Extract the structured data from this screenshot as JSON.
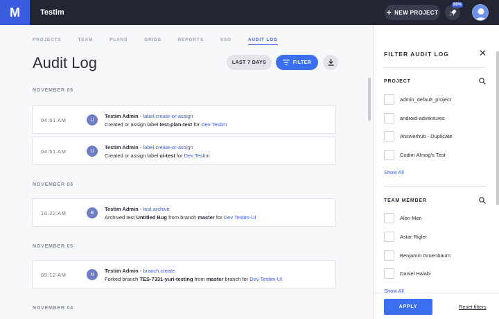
{
  "app": {
    "logo_letter": "M",
    "title": "Testim"
  },
  "header": {
    "new_project_label": "NEW PROJECT",
    "usage_badge": "80%",
    "rocket_icon": "rocket-icon",
    "avatar_icon": "user-avatar-icon"
  },
  "nav": {
    "items": [
      "PROJECTS",
      "TEAM",
      "PLANS",
      "GRIDS",
      "REPORTS",
      "SSO",
      "AUDIT LOG"
    ],
    "active": "AUDIT LOG"
  },
  "page": {
    "title": "Audit Log",
    "range_label": "LAST 7 DAYS",
    "filter_label": "FILTER"
  },
  "log_groups": [
    {
      "date": "NOVEMBER 08",
      "entries": [
        {
          "time": "04:51 AM",
          "initial": "U",
          "user": "Testim Admin",
          "action": "label.create-or-assign",
          "parts": [
            "Created or assign label ",
            "test-plan-test",
            " for ",
            "Dev Testim"
          ]
        },
        {
          "time": "04:51 AM",
          "initial": "U",
          "user": "Testim Admin",
          "action": "label.create-or-assign",
          "parts": [
            "Created or assign label ",
            "ui-test",
            " for ",
            "Dev Testim"
          ]
        }
      ]
    },
    {
      "date": "NOVEMBER 06",
      "entries": [
        {
          "time": "10:22 AM",
          "initial": "B",
          "user": "Testim Admin",
          "action": "test.archive",
          "parts": [
            "Archived test ",
            "Untitled Bug",
            " from branch ",
            "master",
            " for ",
            "Dev Testim-UI"
          ]
        }
      ]
    },
    {
      "date": "NOVEMBER 05",
      "entries": [
        {
          "time": "09:12 AM",
          "initial": "N",
          "user": "Testim Admin",
          "action": "branch.create",
          "parts": [
            "Forked branch ",
            "TES-7331-yuri-testing",
            " from ",
            "master",
            " branch for ",
            "Dev Testim-UI"
          ]
        }
      ]
    },
    {
      "date": "NOVEMBER 04",
      "entries": []
    }
  ],
  "filter_panel": {
    "title": "FILTER AUDIT LOG",
    "project": {
      "title": "PROJECT",
      "options": [
        "admin_default_project",
        "android-adventures",
        "Answerhub - Duplicate",
        "Codim Almog's Test"
      ],
      "show_all": "Show All"
    },
    "team": {
      "title": "TEAM MEMBER",
      "options": [
        "Alon Men",
        "Astar Rigler",
        "Benjamin Gruenbaum",
        "Daniel Halabi"
      ],
      "show_all": "Show All"
    },
    "apply_label": "APPLY",
    "reset_label": "Reset filters"
  }
}
